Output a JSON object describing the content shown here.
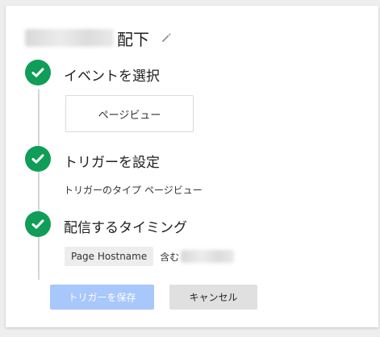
{
  "header": {
    "title_suffix": "配下",
    "edit_icon": "pencil-icon"
  },
  "steps": [
    {
      "title": "イベントを選択",
      "status_icon": "check-icon",
      "status_color": "#0f9d58",
      "event_value": "ページビュー"
    },
    {
      "title": "トリガーを設定",
      "status_icon": "check-icon",
      "status_color": "#0f9d58",
      "type_label": "トリガーのタイプ",
      "type_value": "ページビュー"
    },
    {
      "title": "配信するタイミング",
      "status_icon": "check-icon",
      "status_color": "#0f9d58",
      "condition_variable": "Page Hostname",
      "condition_operator": "含む"
    }
  ],
  "actions": {
    "save_label": "トリガーを保存",
    "cancel_label": "キャンセル",
    "save_color": "#a8c7fa"
  }
}
